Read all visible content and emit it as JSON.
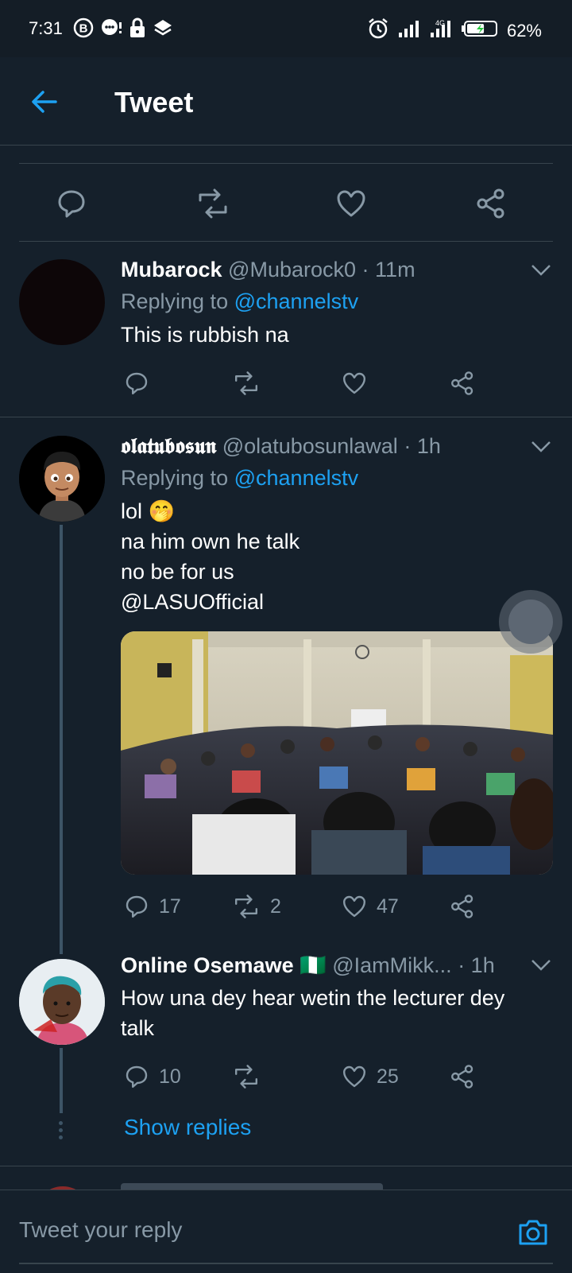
{
  "status_bar": {
    "time": "7:31",
    "battery_percent": "62%",
    "battery_level": 0.62,
    "icons_left": [
      "b-badge-icon",
      "chat-icon",
      "lock-icon",
      "layers-icon"
    ],
    "icons_right": [
      "alarm-icon",
      "signal-icon",
      "signal2-icon",
      "battery-icon"
    ]
  },
  "header": {
    "back_icon": "arrow-left-icon",
    "title": "Tweet"
  },
  "colors": {
    "background": "#15202b",
    "accent": "#1da1f2",
    "muted": "#8899a6",
    "divider": "#38444d"
  },
  "replies": [
    {
      "display_name": "Mubarock",
      "handle": "@Mubarock0",
      "time": "· 11m",
      "replying_prefix": "Replying to",
      "replying_to": "@channelstv",
      "text_lines": [
        "This is rubbish na"
      ],
      "counts": {
        "reply": "",
        "retweet": "",
        "like": ""
      }
    },
    {
      "display_name": "𝖔𝖑𝖆𝖙𝖚𝖇𝖔𝖘𝖚𝖓",
      "handle": "@olatubosunlawal",
      "time": "· 1h",
      "replying_prefix": "Replying to",
      "replying_to": "@channelstv",
      "text_lines": [
        "lol 🤭",
        "na him own he talk",
        "no be for us"
      ],
      "mention": "@LASUOfficial",
      "counts": {
        "reply": "17",
        "retweet": "2",
        "like": "47"
      }
    },
    {
      "display_name": "Online Osemawe",
      "flag": "🇳🇬",
      "handle": "@IamMikk...",
      "time": "· 1h",
      "text_lines": [
        "How una dey hear wetin the lecturer dey",
        "talk"
      ],
      "counts": {
        "reply": "10",
        "retweet": "",
        "like": "25"
      }
    }
  ],
  "show_replies": "Show replies",
  "composer": {
    "placeholder": "Tweet your reply",
    "camera_icon": "camera-icon"
  }
}
